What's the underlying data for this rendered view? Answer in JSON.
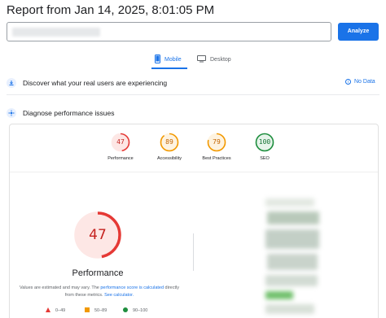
{
  "header": {
    "title": "Report from Jan 14, 2025, 8:01:05 PM"
  },
  "url_input": {
    "value": ""
  },
  "analyze_button": {
    "label": "Analyze"
  },
  "device_tabs": [
    {
      "label": "Mobile",
      "selected": true,
      "icon": "phone-icon"
    },
    {
      "label": "Desktop",
      "selected": false,
      "icon": "monitor-icon"
    }
  ],
  "crux_section": {
    "title": "Discover what your real users are experiencing",
    "no_data_label": "No Data"
  },
  "diagnose_section": {
    "title": "Diagnose performance issues"
  },
  "scores": [
    {
      "label": "Performance",
      "value": "47",
      "color": "#e53935",
      "track": "#fde7e5"
    },
    {
      "label": "Accessibility",
      "value": "89",
      "color": "#f29900",
      "track": "#fef3e0"
    },
    {
      "label": "Best Practices",
      "value": "79",
      "color": "#f29900",
      "track": "#fef3e0"
    },
    {
      "label": "SEO",
      "value": "100",
      "color": "#1e8e3e",
      "track": "#e6f4ea"
    }
  ],
  "performance_detail": {
    "score": "47",
    "score_fraction": 0.47,
    "title": "Performance",
    "note_prefix": "Values are estimated and may vary. The ",
    "note_link1": "performance score is calculated",
    "note_middle": " directly from these metrics. ",
    "note_link2": "See calculator."
  },
  "legend": [
    {
      "label": "0–49",
      "shape": "triangle",
      "color": "#e53935"
    },
    {
      "label": "50–89",
      "shape": "square",
      "color": "#f29900"
    },
    {
      "label": "90–100",
      "shape": "circle",
      "color": "#1e8e3e"
    }
  ]
}
